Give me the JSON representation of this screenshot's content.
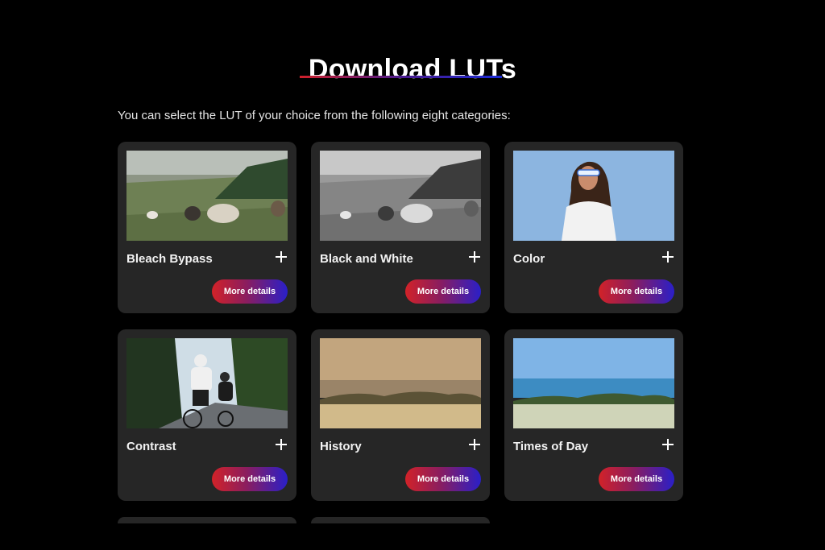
{
  "page": {
    "title": "Download LUTs",
    "intro": "You can select the LUT of your choice from the following eight categories:"
  },
  "cards": [
    {
      "label": "Bleach Bypass",
      "button": "More details",
      "image": "cows-desaturated-photo"
    },
    {
      "label": "Black and White",
      "button": "More details",
      "image": "cows-monochrome-photo"
    },
    {
      "label": "Color",
      "button": "More details",
      "image": "woman-blue-background-photo"
    },
    {
      "label": "Contrast",
      "button": "More details",
      "image": "cyclists-road-photo"
    },
    {
      "label": "History",
      "button": "More details",
      "image": "sepia-landscape-photo"
    },
    {
      "label": "Times of Day",
      "button": "More details",
      "image": "sea-meadow-photo"
    }
  ],
  "icons": {
    "expand": "plus-icon"
  },
  "colors": {
    "background": "#000000",
    "card": "#262626",
    "gradient_start": "#d22228",
    "gradient_end": "#2a1fc8"
  }
}
